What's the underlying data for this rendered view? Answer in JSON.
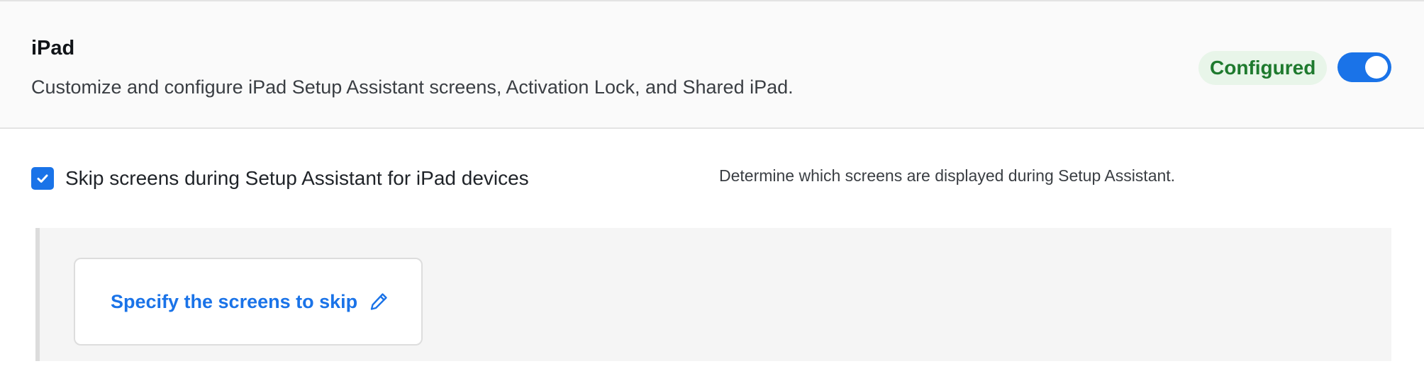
{
  "section": {
    "title": "iPad",
    "description": "Customize and configure iPad Setup Assistant screens, Activation Lock, and Shared iPad.",
    "status_badge": "Configured",
    "toggle_on": true
  },
  "option": {
    "checked": true,
    "label": "Skip screens during Setup Assistant for iPad devices",
    "help_text": "Determine which screens are displayed during Setup Assistant."
  },
  "skip_card": {
    "link_label": "Specify the screens to skip",
    "icon": "pencil-icon"
  },
  "colors": {
    "accent": "#1a73e8",
    "badge_bg": "#e8f5e9",
    "badge_text": "#1e7a2e"
  }
}
